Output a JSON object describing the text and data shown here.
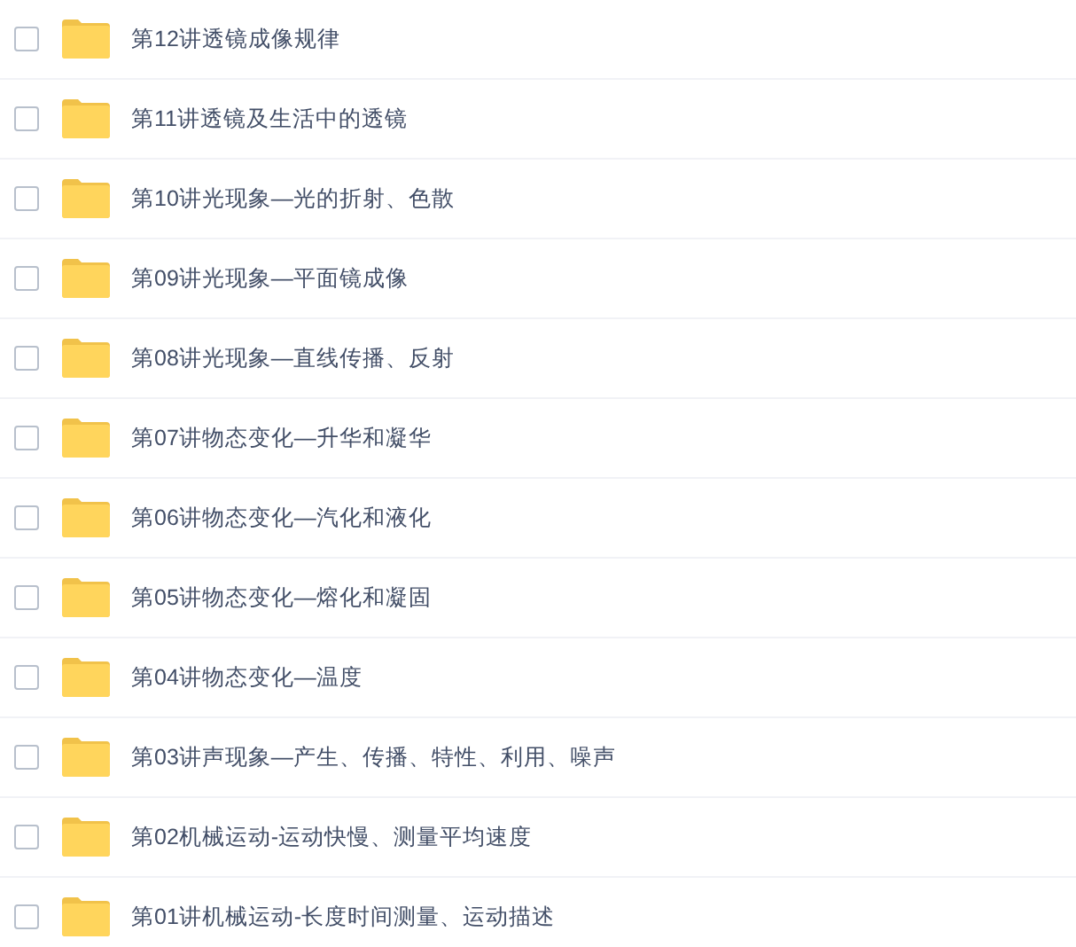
{
  "folders": [
    {
      "name": "第12讲透镜成像规律",
      "checked": false
    },
    {
      "name": "第11讲透镜及生活中的透镜",
      "checked": false
    },
    {
      "name": "第10讲光现象—光的折射、色散",
      "checked": false
    },
    {
      "name": "第09讲光现象—平面镜成像",
      "checked": false
    },
    {
      "name": "第08讲光现象—直线传播、反射",
      "checked": false
    },
    {
      "name": "第07讲物态变化—升华和凝华",
      "checked": false
    },
    {
      "name": "第06讲物态变化—汽化和液化",
      "checked": false
    },
    {
      "name": "第05讲物态变化—熔化和凝固",
      "checked": false
    },
    {
      "name": "第04讲物态变化—温度",
      "checked": false
    },
    {
      "name": "第03讲声现象—产生、传播、特性、利用、噪声",
      "checked": false
    },
    {
      "name": "第02机械运动-运动快慢、测量平均速度",
      "checked": false
    },
    {
      "name": "第01讲机械运动-长度时间测量、运动描述",
      "checked": false
    }
  ]
}
